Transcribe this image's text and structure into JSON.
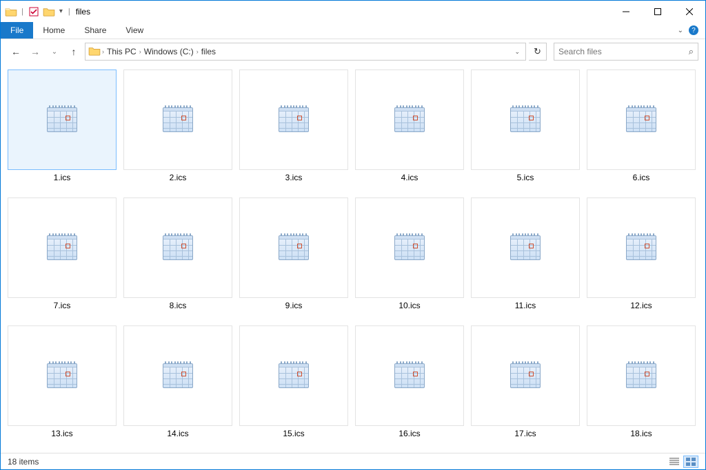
{
  "window": {
    "title": "files"
  },
  "ribbon": {
    "file": "File",
    "tabs": [
      "Home",
      "Share",
      "View"
    ]
  },
  "breadcrumb": {
    "parts": [
      "This PC",
      "Windows (C:)",
      "files"
    ]
  },
  "search": {
    "placeholder": "Search files"
  },
  "files": [
    {
      "name": "1.ics",
      "selected": true
    },
    {
      "name": "2.ics"
    },
    {
      "name": "3.ics"
    },
    {
      "name": "4.ics"
    },
    {
      "name": "5.ics"
    },
    {
      "name": "6.ics"
    },
    {
      "name": "7.ics"
    },
    {
      "name": "8.ics"
    },
    {
      "name": "9.ics"
    },
    {
      "name": "10.ics"
    },
    {
      "name": "11.ics"
    },
    {
      "name": "12.ics"
    },
    {
      "name": "13.ics"
    },
    {
      "name": "14.ics"
    },
    {
      "name": "15.ics"
    },
    {
      "name": "16.ics"
    },
    {
      "name": "17.ics"
    },
    {
      "name": "18.ics"
    }
  ],
  "status": {
    "text": "18 items"
  }
}
